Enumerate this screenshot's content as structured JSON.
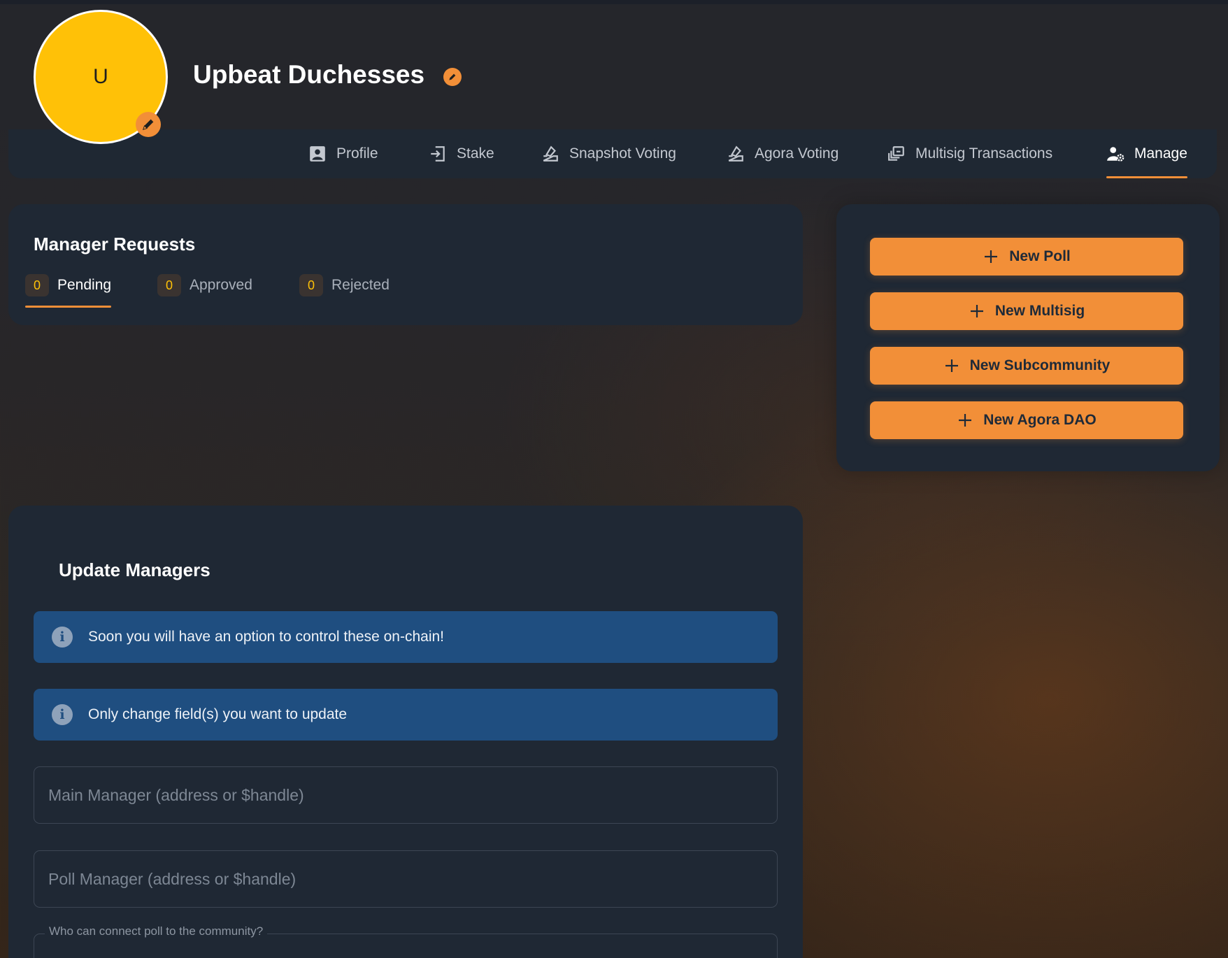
{
  "community": {
    "avatar_letter": "U",
    "name": "Upbeat Duchesses"
  },
  "tabs": [
    {
      "label": "Profile",
      "icon": "profile-icon"
    },
    {
      "label": "Stake",
      "icon": "stake-icon"
    },
    {
      "label": "Snapshot Voting",
      "icon": "ballot-icon"
    },
    {
      "label": "Agora Voting",
      "icon": "ballot-icon"
    },
    {
      "label": "Multisig Transactions",
      "icon": "multisig-icon"
    },
    {
      "label": "Manage",
      "icon": "user-gear-icon",
      "active": true
    }
  ],
  "manager_requests": {
    "title": "Manager Requests",
    "tabs": [
      {
        "label": "Pending",
        "count": "0",
        "active": true
      },
      {
        "label": "Approved",
        "count": "0"
      },
      {
        "label": "Rejected",
        "count": "0"
      }
    ]
  },
  "actions": [
    {
      "label": "New Poll",
      "icon": "plus-icon"
    },
    {
      "label": "New Multisig",
      "icon": "plus-icon"
    },
    {
      "label": "New Subcommunity",
      "icon": "plus-icon"
    },
    {
      "label": "New Agora DAO",
      "icon": "plus-icon"
    }
  ],
  "update_managers": {
    "title": "Update Managers",
    "alerts": [
      {
        "text": "Soon you will have an option to control these on-chain!",
        "icon": "info-icon"
      },
      {
        "text": "Only change field(s) you want to update",
        "icon": "info-icon"
      }
    ],
    "main_manager_placeholder": "Main Manager (address or $handle)",
    "poll_manager_placeholder": "Poll Manager (address or $handle)",
    "connect_poll_legend": "Who can connect poll to the community?"
  },
  "colors": {
    "accent": "#f28f38",
    "avatar": "#ffc107",
    "card": "#1f2834",
    "alert": "#1f4e80"
  }
}
